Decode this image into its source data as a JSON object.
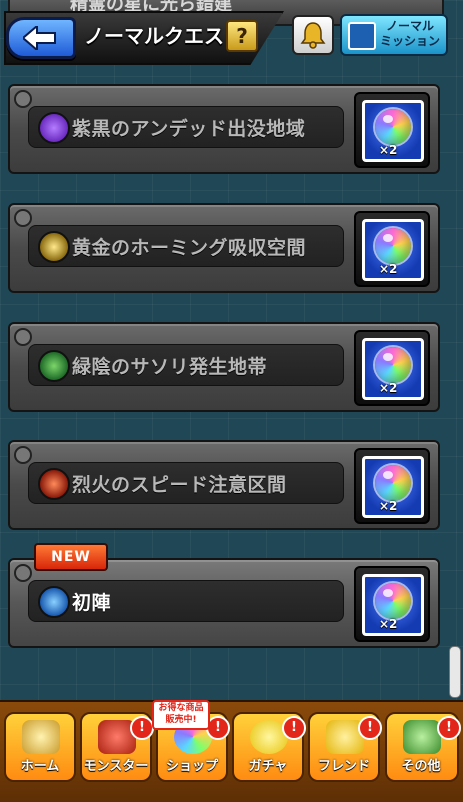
{
  "header": {
    "title": "ノーマルクエスト",
    "help_label": "?",
    "mission_label_line1": "ノーマル",
    "mission_label_line2": "ミッション"
  },
  "partial_quest": {
    "name": "精霊の星に光ら錯建"
  },
  "quests": [
    {
      "name": "紫黒のアンデッド出没地域",
      "element_icon": "purple-element-icon",
      "element_color": "#6a2bbf",
      "reward_qty": "×2",
      "is_new": false
    },
    {
      "name": "黄金のホーミング吸収空間",
      "element_icon": "gold-element-icon",
      "element_color": "#d0b23a",
      "reward_qty": "×2",
      "is_new": false
    },
    {
      "name": "緑陰のサソリ発生地帯",
      "element_icon": "green-element-icon",
      "element_color": "#2f9a3a",
      "reward_qty": "×2",
      "is_new": false
    },
    {
      "name": "烈火のスピード注意区間",
      "element_icon": "fire-element-icon",
      "element_color": "#c23a1a",
      "reward_qty": "×2",
      "is_new": false
    },
    {
      "name": "初陣",
      "element_icon": "water-element-icon",
      "element_color": "#2a8ae6",
      "reward_qty": "×2",
      "is_new": true
    }
  ],
  "new_label": "NEW",
  "bottom_nav": {
    "promo_line1": "お得な商品",
    "promo_line2": "販売中!",
    "items": [
      {
        "label": "ホーム",
        "icon": "home-icon",
        "alert": ""
      },
      {
        "label": "モンスター",
        "icon": "monster-icon",
        "alert": "!"
      },
      {
        "label": "ショップ",
        "icon": "shop-icon",
        "alert": "!"
      },
      {
        "label": "ガチャ",
        "icon": "gacha-icon",
        "alert": "!"
      },
      {
        "label": "フレンド",
        "icon": "friend-icon",
        "alert": "!"
      },
      {
        "label": "その他",
        "icon": "other-icon",
        "alert": "!"
      }
    ]
  },
  "colors": {
    "accent": "#ff8b12",
    "reward_orb_bg": "#153bb2"
  }
}
